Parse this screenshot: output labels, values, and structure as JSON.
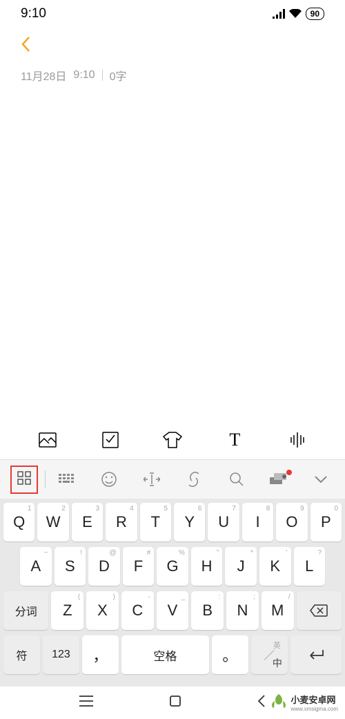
{
  "status": {
    "time": "9:10",
    "battery": "90"
  },
  "note": {
    "date": "11月28日",
    "time": "9:10",
    "count": "0字"
  },
  "toolbar1": {
    "image": "image-icon",
    "checkbox": "checkbox-icon",
    "tshirt": "theme-icon",
    "text": "T",
    "voice": "voice-icon"
  },
  "toolbar2": {
    "grid": "grid-icon",
    "keyboard": "keyboard-icon",
    "emoji": "emoji-icon",
    "cursor": "cursor-icon",
    "link": "link-icon",
    "search": "search-icon",
    "translate": "translate-icon",
    "collapse": "collapse-icon"
  },
  "kb": {
    "row1": [
      {
        "m": "Q",
        "h": "1"
      },
      {
        "m": "W",
        "h": "2"
      },
      {
        "m": "E",
        "h": "3"
      },
      {
        "m": "R",
        "h": "4"
      },
      {
        "m": "T",
        "h": "5"
      },
      {
        "m": "Y",
        "h": "6"
      },
      {
        "m": "U",
        "h": "7"
      },
      {
        "m": "I",
        "h": "8"
      },
      {
        "m": "O",
        "h": "9"
      },
      {
        "m": "P",
        "h": "0"
      }
    ],
    "row2": [
      {
        "m": "A",
        "h": "~"
      },
      {
        "m": "S",
        "h": "!"
      },
      {
        "m": "D",
        "h": "@"
      },
      {
        "m": "F",
        "h": "#"
      },
      {
        "m": "G",
        "h": "%"
      },
      {
        "m": "H",
        "h": "\""
      },
      {
        "m": "J",
        "h": "*"
      },
      {
        "m": "K",
        "h": "'"
      },
      {
        "m": "L",
        "h": "?"
      }
    ],
    "row3": {
      "left": "分词",
      "keys": [
        {
          "m": "Z",
          "h": "("
        },
        {
          "m": "X",
          "h": ")"
        },
        {
          "m": "C",
          "h": "-"
        },
        {
          "m": "V",
          "h": "_"
        },
        {
          "m": "B",
          "h": ":"
        },
        {
          "m": "N",
          "h": ";"
        },
        {
          "m": "M",
          "h": "/"
        }
      ],
      "right": "backspace"
    },
    "row4": {
      "sym": "符",
      "num": "123",
      "comma": "，",
      "space": "空格",
      "period": "。",
      "lang_top": "英",
      "lang_bot": "中",
      "enter": "enter"
    }
  },
  "watermark": {
    "name": "小麦安卓网",
    "url": "www.xmsigma.com"
  }
}
